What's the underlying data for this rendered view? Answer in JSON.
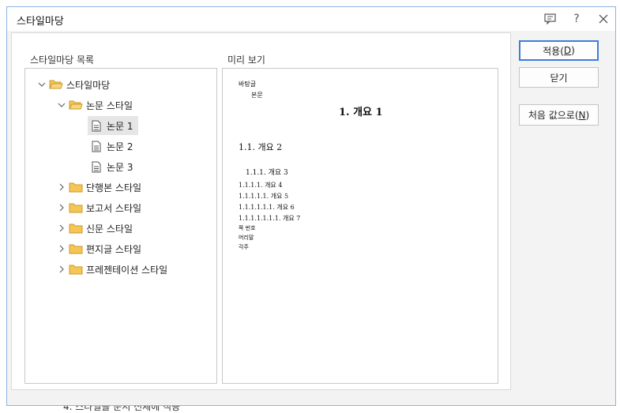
{
  "background": {
    "doc_line": "4. 스타일을 문서 전체에 적용"
  },
  "window": {
    "title": "스타일마당"
  },
  "titlebar_icons": [
    "comment-icon",
    "help-icon",
    "close-icon"
  ],
  "list_panel": {
    "label": "스타일마당 목록"
  },
  "tree": {
    "root": "스타일마당",
    "thesis": "논문 스타일",
    "thesis_items": [
      "논문 1",
      "논문 2",
      "논문 3"
    ],
    "folders": [
      "단행본 스타일",
      "보고서 스타일",
      "신문 스타일",
      "편지글 스타일",
      "프레젠테이션 스타일"
    ]
  },
  "preview": {
    "label": "미리 보기",
    "lines": {
      "normal": "바탕글",
      "body": "본문",
      "h1": "1. 개요 1",
      "h2": "1.1. 개요 2",
      "h3": "1.1.1. 개요 3",
      "h4": "1.1.1.1. 개요 4",
      "h5": "1.1.1.1.1. 개요 5",
      "h6": "1.1.1.1.1.1. 개요 6",
      "h7": "1.1.1.1.1.1.1. 개요 7",
      "page_number": "쪽 번호",
      "header": "머리말",
      "footnote": "각주"
    }
  },
  "buttons": {
    "apply": {
      "text": "적용(",
      "key": "D",
      "close": ")"
    },
    "close": "닫기",
    "reset": {
      "text": "처음 값으로(",
      "key": "N",
      "close": ")"
    }
  },
  "colors": {
    "folder": "#f5c654",
    "accent": "#3c7fd6",
    "selection": "#e6e6e6"
  }
}
